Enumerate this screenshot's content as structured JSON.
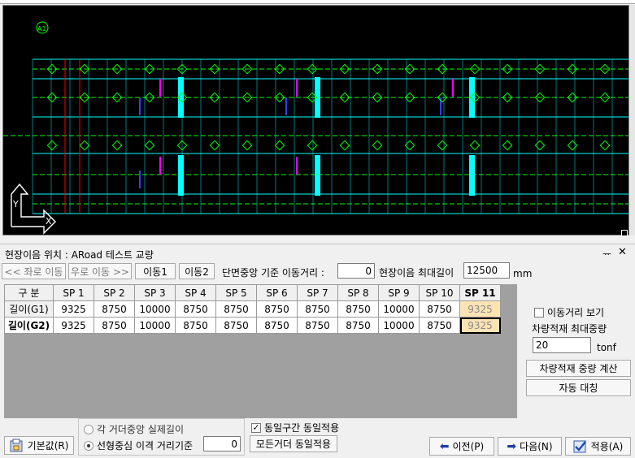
{
  "panel": {
    "title": "현장이음 위치 : ARoad 테스트 교량",
    "pin_glyph": "ᅲ",
    "close_glyph": "✕"
  },
  "toolbar": {
    "move_left": "<< 좌로 이동",
    "move_right": "우로 이동 >>",
    "move1": "이동1",
    "move2": "이동2",
    "center_move_label": "단면중앙 기준 이동거리 :",
    "center_move_value": "0",
    "max_length_label": "현장이음 최대길이",
    "max_length_value": "12500",
    "max_length_unit": "mm"
  },
  "grid": {
    "corner": "구 분",
    "columns": [
      "SP 1",
      "SP 2",
      "SP 3",
      "SP 4",
      "SP 5",
      "SP 6",
      "SP 7",
      "SP 8",
      "SP 9",
      "SP 10",
      "SP 11"
    ],
    "rows": [
      {
        "label": "길이(G1)",
        "values": [
          "9325",
          "8750",
          "10000",
          "8750",
          "8750",
          "8750",
          "8750",
          "8750",
          "10000",
          "8750",
          "9325"
        ]
      },
      {
        "label": "길이(G2)",
        "values": [
          "9325",
          "8750",
          "10000",
          "8750",
          "8750",
          "8750",
          "8750",
          "8750",
          "10000",
          "8750",
          "9325"
        ]
      }
    ]
  },
  "side": {
    "show_distance": "이동거리 보기",
    "max_load_label": "차량적재 최대중량",
    "max_load_value": "20",
    "max_load_unit": "tonf",
    "calc_button": "차량적재 중량 계산",
    "auto_sym_button": "자동 대칭"
  },
  "bottom": {
    "default_button": "기본값(R)",
    "radio_each": "각 거더중앙 실제길이",
    "radio_line": "선형중심 이격 거리기준",
    "radio_line_value": "0",
    "same_section": "동일구간 동일적용",
    "all_girders_button": "모든거더 동일적용",
    "prev_button": "이전(P)",
    "next_button": "다음(N)",
    "apply_button": "적용(A)"
  },
  "cad": {
    "marker_label": "A1",
    "axis_y": "Y",
    "axis_x": "X",
    "line_color": "#00ffff",
    "green_color": "#00ff00",
    "red_color": "#ff0000",
    "blue_color": "#3040ff",
    "magenta_color": "#ff00ff"
  }
}
